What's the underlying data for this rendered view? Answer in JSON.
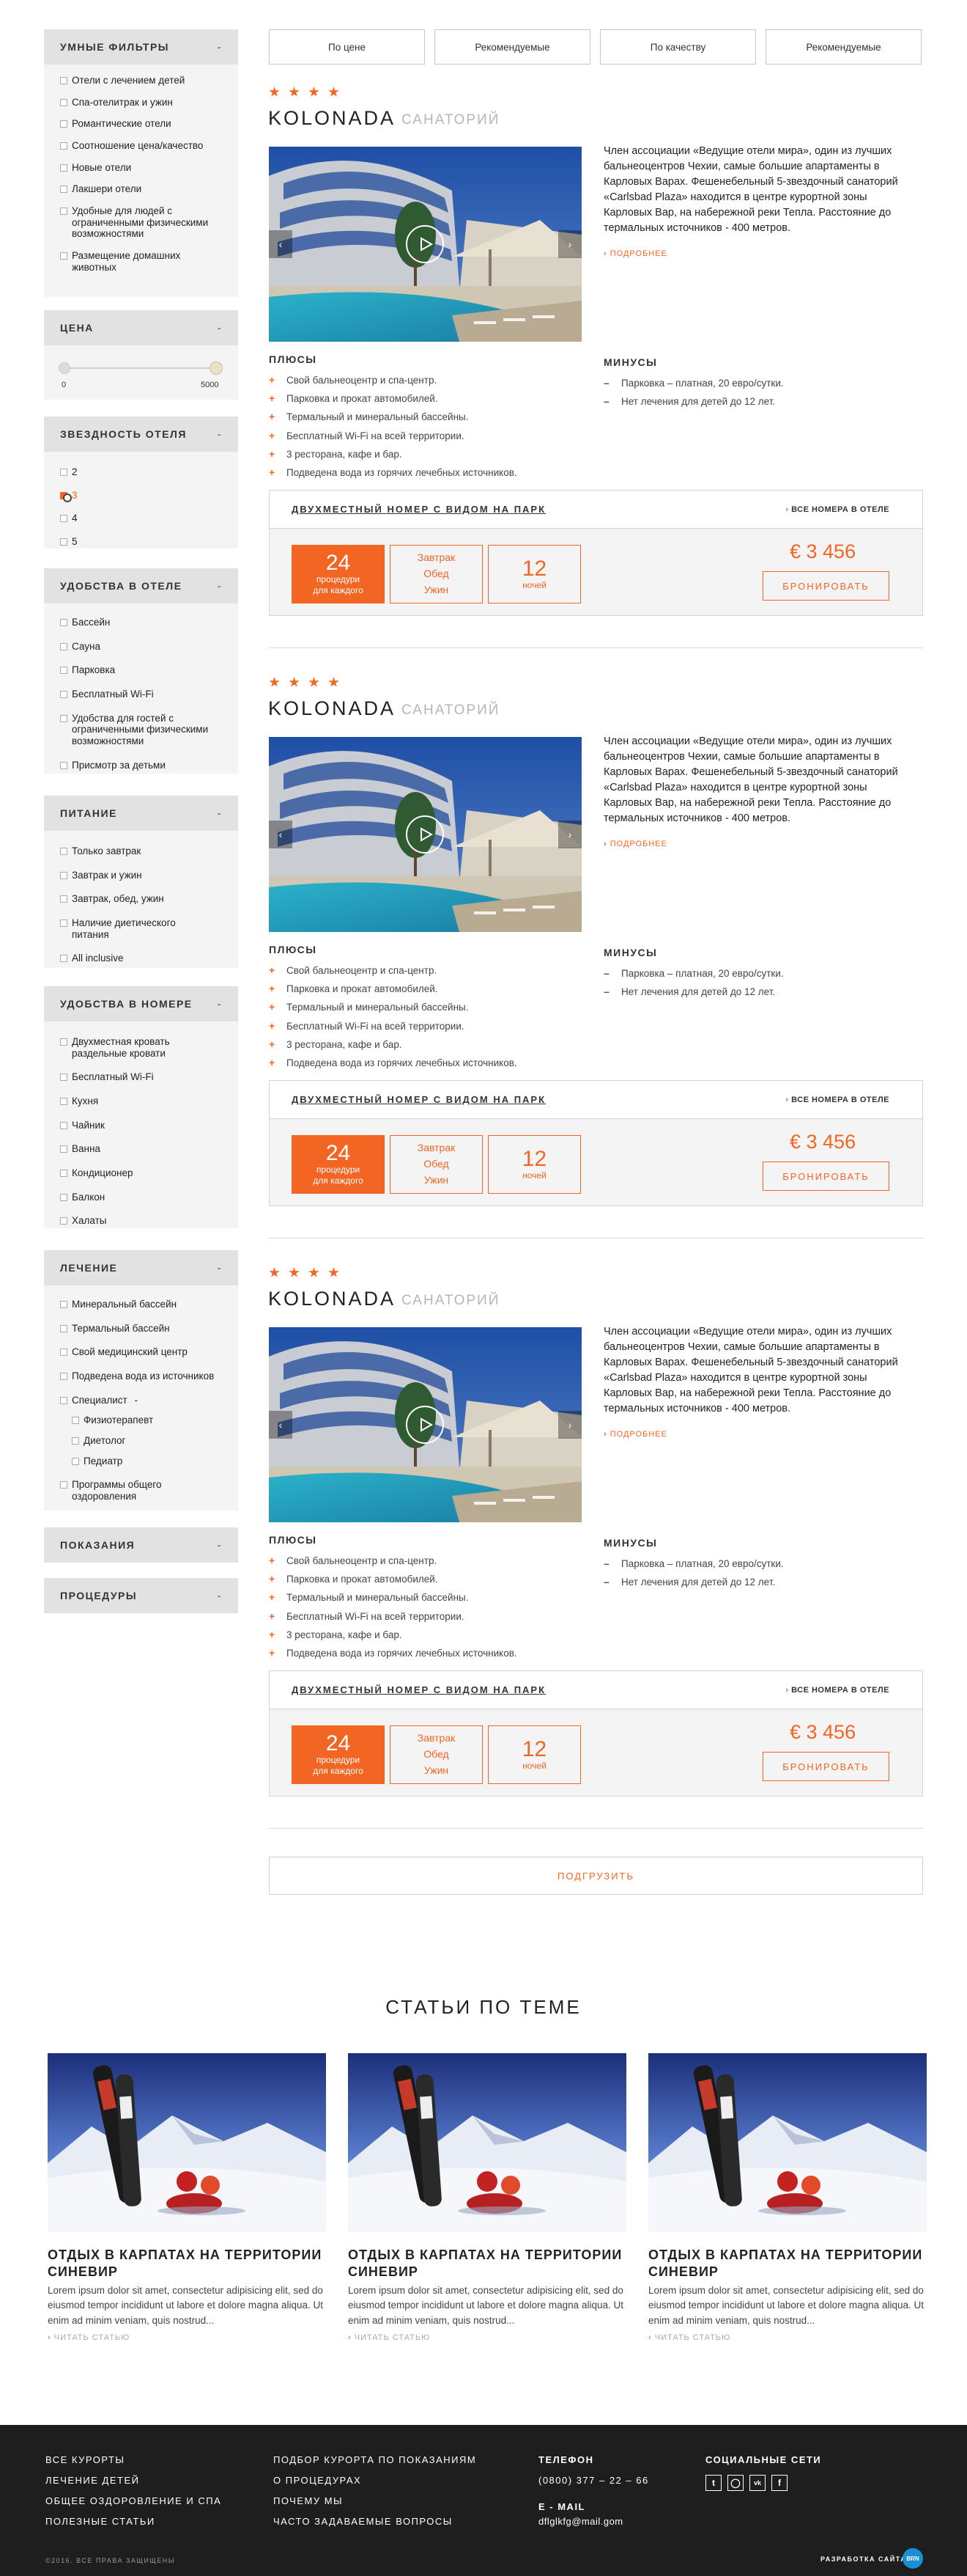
{
  "sort_tabs": [
    "По цене",
    "Рекомендуемые",
    "По качеству",
    "Рекомендуемые"
  ],
  "sidebar": {
    "smart_filters": {
      "title": "УМНЫЕ ФИЛЬТРЫ",
      "toggle": "-",
      "items": [
        "Отели с лечением детей",
        "Спа-отелитрак и ужин",
        "Романтические отели",
        "Соотношение цена/качество",
        "Новые отели",
        "Лакшери отели",
        "Удобные для людей с ограниченными физическими возможностями",
        "Размещение домашних животных"
      ]
    },
    "price": {
      "title": "ЦЕНА",
      "toggle": "-",
      "min": "0",
      "max": "5000"
    },
    "stars": {
      "title": "ЗВЕЗДНОСТЬ ОТЕЛЯ",
      "toggle": "-",
      "items": [
        "2",
        "3",
        "4",
        "5"
      ]
    },
    "hotel_amenities": {
      "title": "УДОБСТВА В ОТЕЛЕ",
      "toggle": "-",
      "items": [
        "Бассейн",
        "Сауна",
        "Парковка",
        "Бесплатный Wi-Fi",
        "Удобства для гостей с ограниченными физическими возможностями",
        "Присмотр за детьми"
      ]
    },
    "food": {
      "title": "ПИТАНИЕ",
      "toggle": "-",
      "items": [
        "Только завтрак",
        "Завтрак и ужин",
        "Завтрак, обед, ужин",
        "Наличие диетического питания",
        "All inclusive"
      ]
    },
    "room_amenities": {
      "title": "УДОБСТВА В НОМЕРЕ",
      "toggle": "-",
      "items": [
        "Двухместная кровать раздельные кровати",
        "Бесплатный Wi-Fi",
        "Кухня",
        "Чайник",
        "Ванна",
        "Кондиционер",
        "Балкон",
        "Халаты"
      ]
    },
    "treatment": {
      "title": "ЛЕЧЕНИЕ",
      "toggle": "-",
      "items": [
        "Минеральный бассейн",
        "Термальный бассейн",
        "Свой медицинский центр",
        "Подведена вода из источников"
      ],
      "specialist": "Специалист",
      "specialist_toggle": "-",
      "subitems": [
        "Физиотерапевт",
        "Диетолог",
        "Педиатр"
      ],
      "last": "Программы общего оздоровления"
    },
    "indications": {
      "title": "ПОКАЗАНИЯ",
      "toggle": "-"
    },
    "procedures": {
      "title": "ПРОЦЕДУРЫ",
      "toggle": "-"
    }
  },
  "hotel": {
    "name": "KOLONADA",
    "type": "САНАТОРИЙ",
    "stars": 4,
    "description": "Член ассоциации «Ведущие отели мира», один из лучших бальнеоцентров Чехии, самые большие апартаменты в Карловых Варах. Фешенебельный 5-звездочный санаторий «Carlsbad Plaza» находится в центре курортной зоны Карловых Вар, на набережной реки Тепла. Расстояние до термальных источников - 400 метров.",
    "more": "ПОДРОБНЕЕ",
    "pros_title": "ПЛЮСЫ",
    "cons_title": "МИНУСЫ",
    "pros": [
      "Свой бальнеоцентр и спа-центр.",
      "Парковка и прокат автомобилей.",
      "Термальный и минеральный бассейны.",
      "Бесплатный Wi-Fi на всей территории.",
      "3 ресторана, кафе и бар.",
      "Подведена вода из горячих лечебных источников."
    ],
    "cons": [
      "Парковка – платная, 20 евро/сутки.",
      "Нет лечения для детей до 12 лет."
    ],
    "offer": {
      "room": "ДВУХМЕСТНЫЙ НОМЕР С ВИДОМ НА ПАРК",
      "all_rooms": "ВСЕ НОМЕРА В ОТЕЛЕ",
      "procedures_count": "24",
      "procedures_label_1": "процедури",
      "procedures_label_2": "для каждого",
      "meals": [
        "Завтрак",
        "Обед",
        "Ужин"
      ],
      "nights_count": "12",
      "nights_label": "ночей",
      "price": "€ 3 456",
      "book": "БРОНИРОВАТЬ"
    }
  },
  "load_more": "ПОДГРУЗИТЬ",
  "articles": {
    "title": "СТАТЬИ ПО ТЕМЕ",
    "items": [
      {
        "title": "ОТДЫХ В КАРПАТАХ НА ТЕРРИТОРИИ СИНЕВИР",
        "text": "Lorem ipsum dolor sit amet, consectetur adipisicing elit, sed do eiusmod tempor incididunt ut labore et dolore magna aliqua. Ut enim ad minim veniam, quis nostrud...",
        "more": "ЧИТАТЬ СТАТЬЮ"
      },
      {
        "title": "ОТДЫХ В КАРПАТАХ НА ТЕРРИТОРИИ СИНЕВИР",
        "text": "Lorem ipsum dolor sit amet, consectetur adipisicing elit, sed do eiusmod tempor incididunt ut labore et dolore magna aliqua. Ut enim ad minim veniam, quis nostrud...",
        "more": "ЧИТАТЬ СТАТЬЮ"
      },
      {
        "title": "ОТДЫХ В КАРПАТАХ НА ТЕРРИТОРИИ СИНЕВИР",
        "text": "Lorem ipsum dolor sit amet, consectetur adipisicing elit, sed do eiusmod tempor incididunt ut labore et dolore magna aliqua. Ut enim ad minim veniam, quis nostrud...",
        "more": "ЧИТАТЬ СТАТЬЮ"
      }
    ]
  },
  "footer": {
    "col1": [
      "ВСЕ КУРОРТЫ",
      "ЛЕЧЕНИЕ ДЕТЕЙ",
      "ОБЩЕЕ ОЗДОРОВЛЕНИЕ И СПА",
      "ПОЛЕЗНЫЕ СТАТЬИ"
    ],
    "col2": [
      "ПОДБОР КУРОРТА ПО ПОКАЗАНИЯМ",
      "О ПРОЦЕДУРАХ",
      "ПОЧЕМУ МЫ",
      "ЧАСТО ЗАДАВАЕМЫЕ ВОПРОСЫ"
    ],
    "phone_title": "ТЕЛЕФОН",
    "phone": "(0800) 377 – 22 – 66",
    "email_title": "E - MAIL",
    "email": "dflglkfg@mail.gom",
    "social_title": "СОЦИАЛЬНЫЕ СЕТИ",
    "social_icons": [
      "twitter-icon",
      "instagram-icon",
      "vk-icon",
      "facebook-icon"
    ],
    "copyright": "©2016. ВСЕ ПРАВА ЗАЩИЩЕНЫ",
    "dev": "РАЗРАБОТКА САЙТА",
    "dev_logo": "BRN"
  },
  "colors": {
    "accent": "#f26522",
    "sidebar_header": "#e2e2e2",
    "sidebar_bg": "#f4f4f4",
    "footer": "#1e1e1e"
  }
}
